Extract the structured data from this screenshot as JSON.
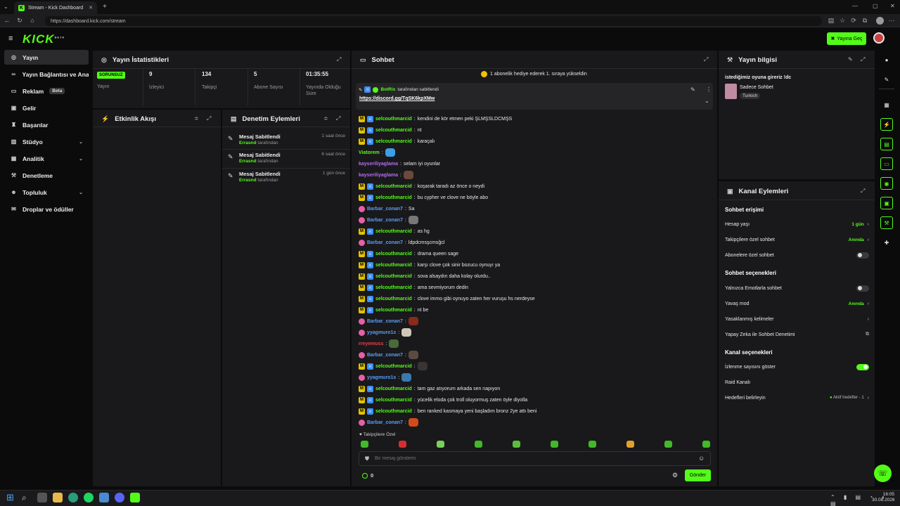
{
  "browser": {
    "tab_title": "Stream - Kick Dashboard",
    "url": "https://dashboard.kick.com/stream",
    "tab_close": "✕",
    "new_tab": "+"
  },
  "header": {
    "logo": "KICK",
    "logo_sup": "BETA",
    "go_live": "Yayına Geç"
  },
  "sidebar": {
    "items": [
      {
        "label": "Yayın",
        "icon": "stream-icon"
      },
      {
        "label": "Yayın Bağlantısı ve Anahtarı",
        "icon": "link-icon"
      },
      {
        "label": "Reklam",
        "badge": "Beta",
        "icon": "ad-icon"
      },
      {
        "label": "Gelir",
        "icon": "revenue-icon"
      },
      {
        "label": "Başarılar",
        "icon": "trophy-icon"
      },
      {
        "label": "Stüdyo",
        "icon": "studio-icon"
      },
      {
        "label": "Analitik",
        "icon": "analytics-icon"
      },
      {
        "label": "Denetleme",
        "icon": "moderation-icon"
      },
      {
        "label": "Topluluk",
        "icon": "community-icon"
      },
      {
        "label": "Droplar ve ödüller",
        "icon": "gift-icon"
      }
    ]
  },
  "stats": {
    "title": "Yayın İstatistikleri",
    "status_badge": "SORUNSUZ",
    "items": [
      {
        "value": "",
        "label": "Yayın"
      },
      {
        "value": "9",
        "label": "İzleyici"
      },
      {
        "value": "134",
        "label": "Takipçi"
      },
      {
        "value": "5",
        "label": "Abone Sayısı"
      },
      {
        "value": "01:35:55",
        "label": "Yayında Olduğu Süre"
      }
    ]
  },
  "activity": {
    "title": "Etkinlik Akışı"
  },
  "moderation": {
    "title": "Denetim Eylemleri",
    "events": [
      {
        "title": "Mesaj Sabitlendi",
        "user": "Errasnd",
        "suffix": "tarafından",
        "time": "1 saat önce"
      },
      {
        "title": "Mesaj Sabitlendi",
        "user": "Errasnd",
        "suffix": "tarafından",
        "time": "6 saat önce"
      },
      {
        "title": "Mesaj Sabitlendi",
        "user": "Errasnd",
        "suffix": "tarafından",
        "time": "1 gün önce"
      }
    ]
  },
  "chat": {
    "title": "Sohbet",
    "banner": "1 abonelik hediye ederek 1. sıraya yükseldin",
    "pinned": {
      "by": "BotRix",
      "suffix": "tarafından sabitlendi",
      "link": "https://discord.gg/TqSK6kpXMw"
    },
    "messages": [
      {
        "user": "selcouthmarcid",
        "badges": 2,
        "text": "kendini de kör etmen peki ŞLMŞSLDCMŞS",
        "color": "#53fc18"
      },
      {
        "user": "selcouthmarcid",
        "badges": 2,
        "text": "nt",
        "color": "#53fc18"
      },
      {
        "user": "selcouthmarcid",
        "badges": 2,
        "text": "karaçalı",
        "color": "#53fc18"
      },
      {
        "user": "Viatorem",
        "badges": 0,
        "text": "",
        "color": "#53fc18",
        "emote": "#3a9fe8"
      },
      {
        "user": "kayseriliyaglama",
        "badges": 0,
        "text": "selam iyi oyunlar",
        "color": "#b36cf2"
      },
      {
        "user": "kayseriliyaglama",
        "badges": 0,
        "text": "",
        "color": "#b36cf2",
        "emote": "#6a4a3a"
      },
      {
        "user": "selcouthmarcid",
        "badges": 2,
        "text": "koşarak taradı az önce o neydi",
        "color": "#53fc18"
      },
      {
        "user": "selcouthmarcid",
        "badges": 2,
        "text": "bu cypher ve clove ne böyle abo",
        "color": "#53fc18"
      },
      {
        "user": "Barbar_conan7",
        "badges": 1,
        "text": "Sa",
        "color": "#5a9cf5"
      },
      {
        "user": "Barbar_conan7",
        "badges": 1,
        "text": "",
        "color": "#5a9cf5",
        "emote": "#777"
      },
      {
        "user": "selcouthmarcid",
        "badges": 2,
        "text": "as hg",
        "color": "#53fc18"
      },
      {
        "user": "Barbar_conan7",
        "badges": 1,
        "text": "ldpdcmsşcmsğcl",
        "color": "#5a9cf5"
      },
      {
        "user": "selcouthmarcid",
        "badges": 2,
        "text": "drama queen sage",
        "color": "#53fc18"
      },
      {
        "user": "selcouthmarcid",
        "badges": 2,
        "text": "karşı clove çok sinir bozucu oynuyı ya",
        "color": "#53fc18"
      },
      {
        "user": "selcouthmarcid",
        "badges": 2,
        "text": "sova alsaydın daha kolay olurdu..",
        "color": "#53fc18"
      },
      {
        "user": "selcouthmarcid",
        "badges": 2,
        "text": "ama sevmiyorum dedin",
        "color": "#53fc18"
      },
      {
        "user": "selcouthmarcid",
        "badges": 2,
        "text": "clove immo gibi oynuyo zaten her vuruşu hs nerdeyse",
        "color": "#53fc18"
      },
      {
        "user": "selcouthmarcid",
        "badges": 2,
        "text": "nt be",
        "color": "#53fc18"
      },
      {
        "user": "Barbar_conan7",
        "badges": 1,
        "text": "",
        "color": "#5a9cf5",
        "emote": "#8a2a1a"
      },
      {
        "user": "yyagmuro1s",
        "badges": 1,
        "text": "",
        "color": "#5a9cf5",
        "emote": "#cfc8b8"
      },
      {
        "user": "rreyemuss",
        "badges": 0,
        "text": "",
        "color": "#f03a4a",
        "emote": "#4a6a3a"
      },
      {
        "user": "Barbar_conan7",
        "badges": 1,
        "text": "",
        "color": "#5a9cf5",
        "emote": "#5a4a42"
      },
      {
        "user": "selcouthmarcid",
        "badges": 2,
        "text": "",
        "color": "#53fc18",
        "emote": "#3a3434"
      },
      {
        "user": "yyagmuro1s",
        "badges": 1,
        "text": "",
        "color": "#5a9cf5",
        "emote": "#3a7ab0"
      },
      {
        "user": "selcouthmarcid",
        "badges": 2,
        "text": "tam gaz atıyorum arkada sen napıyon",
        "color": "#53fc18"
      },
      {
        "user": "selcouthmarcid",
        "badges": 2,
        "text": "yücelik eloda çok troll oluyormuş zaten öyle diyolla",
        "color": "#53fc18"
      },
      {
        "user": "selcouthmarcid",
        "badges": 2,
        "text": "ben ranked kasmaya yeni başladım bronz 2ye attı beni",
        "color": "#53fc18"
      },
      {
        "user": "Barbar_conan7",
        "badges": 1,
        "text": "",
        "color": "#5a9cf5",
        "emote": "#d24a1a"
      }
    ],
    "followers_only": "Takipçilere Özel",
    "input_placeholder": "Bir mesaj gönderin",
    "viewer_count": "0",
    "send": "Gönder"
  },
  "stream_info": {
    "title": "Yayın bilgisi",
    "stream_title": "istediğimiz oyuna gireriz !dc",
    "category": "Sadece Sohbet",
    "tag": "Turkish"
  },
  "channel_actions": {
    "title": "Kanal Eylemleri",
    "chat_access": "Sohbet erişimi",
    "account_age": "Hesap yaşı",
    "account_age_val": "1 gün",
    "followers_only": "Takipçilere özel sohbet",
    "followers_only_val": "Anında",
    "subs_only": "Abonelere özel sohbet",
    "chat_options": "Sohbet seçenekleri",
    "emotes_only": "Yalnızca Emotlarla sohbet",
    "slow_mode": "Yavaş mod",
    "slow_mode_val": "Anında",
    "banned_words": "Yasaklanmış kelimeler",
    "ai_mod": "Yapay Zeka ile Sohbet Denetimi",
    "channel_options": "Kanal seçenekleri",
    "show_views": "İzlenme sayısını göster",
    "raid": "Raid Kanalı",
    "goals": "Hedefleri belirleyin",
    "goals_val": "Aktif hedefler - 1"
  },
  "taskbar": {
    "time": "16:05",
    "date": "30.08.2026"
  },
  "colors": {
    "accent": "#53fc18",
    "panel": "#19191b",
    "bg": "#0b0b0c"
  }
}
